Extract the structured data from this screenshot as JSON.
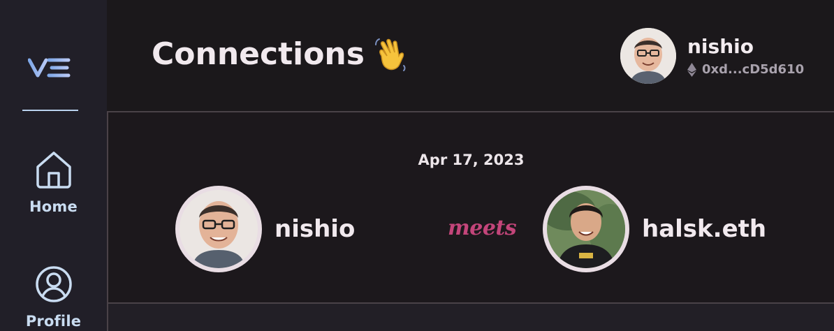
{
  "sidebar": {
    "logo": "VE",
    "items": [
      {
        "label": "Home",
        "icon": "home-icon"
      },
      {
        "label": "Profile",
        "icon": "profile-icon"
      }
    ]
  },
  "header": {
    "title": "Connections",
    "title_emoji": "waving-hand-icon",
    "user": {
      "name": "nishio",
      "wallet": "0xd...cD5d610",
      "wallet_icon": "ethereum-icon"
    }
  },
  "connection": {
    "date": "Apr 17, 2023",
    "left_person": "nishio",
    "connector": "meets",
    "right_person": "halsk.eth"
  },
  "colors": {
    "background": "#1b181b",
    "sidebar": "#211f28",
    "nav_accent": "#c9dcf1",
    "meets_accent": "#c3457a",
    "wallet_text": "#a9a2ad"
  }
}
